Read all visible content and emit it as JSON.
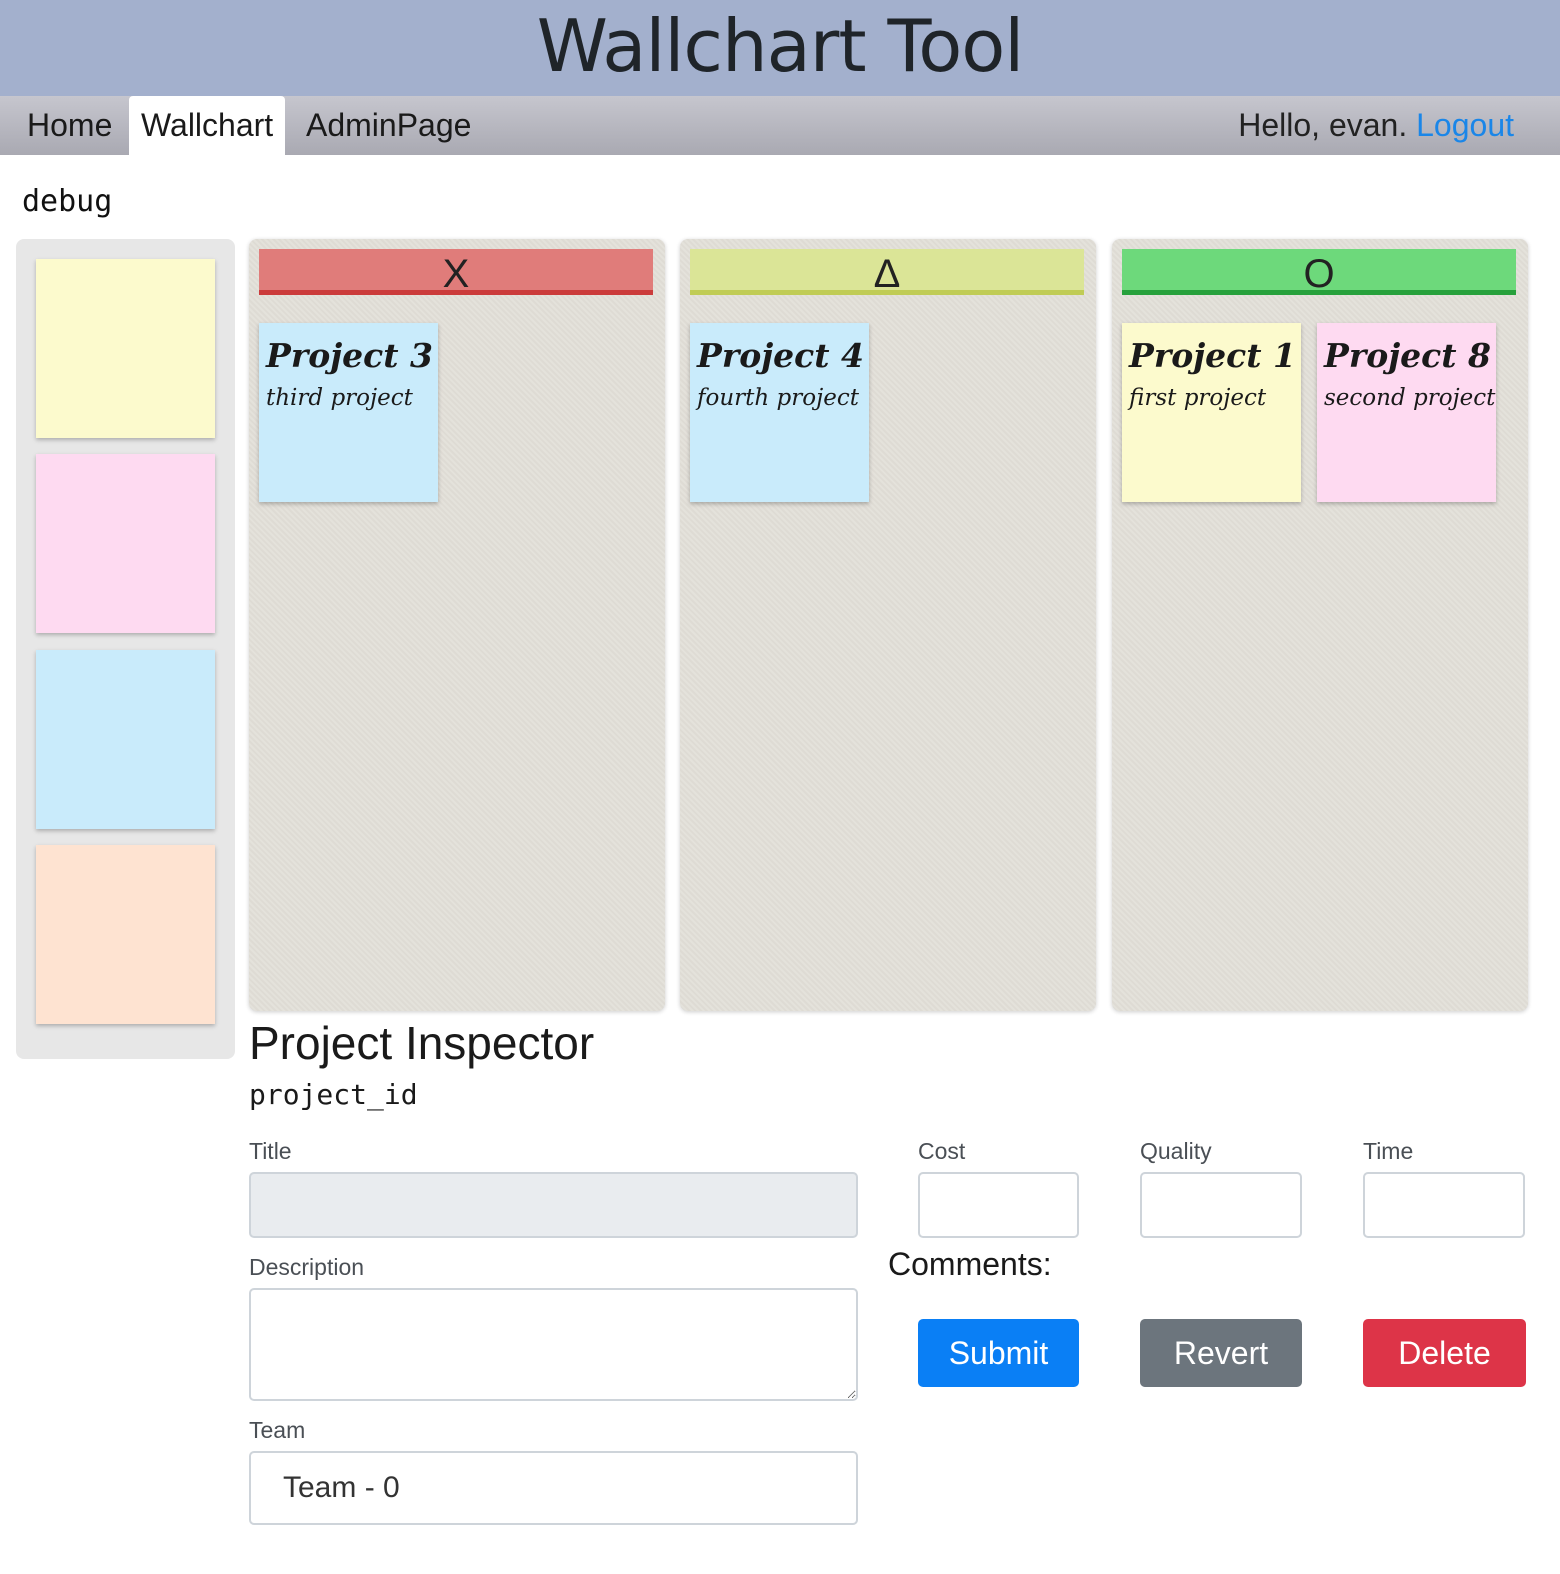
{
  "header": {
    "title": "Wallchart Tool"
  },
  "nav": {
    "tabs": [
      {
        "label": "Home"
      },
      {
        "label": "Wallchart"
      },
      {
        "label": "AdminPage"
      }
    ],
    "greeting": "Hello, evan.",
    "logout": "Logout"
  },
  "debug_label": "debug",
  "palette": {
    "colors": [
      "#fcfacd",
      "#fedaf1",
      "#c9ebfb",
      "#fee3d1"
    ]
  },
  "columns": [
    {
      "header": "X",
      "header_color": "#e07c7a",
      "header_border": "#cb3b3b",
      "notes": [
        {
          "title": "Project 3",
          "description": "third project",
          "color": "#c9ebfb"
        }
      ]
    },
    {
      "header": "Δ",
      "header_color": "#dbe597",
      "header_border": "#c0cc55",
      "notes": [
        {
          "title": "Project 4",
          "description": "fourth project",
          "color": "#c9ebfb"
        }
      ]
    },
    {
      "header": "O",
      "header_color": "#6dd97b",
      "header_border": "#27a13c",
      "notes": [
        {
          "title": "Project 1",
          "description": "first project",
          "color": "#fcfacd"
        },
        {
          "title": "Project 8",
          "description": "second project",
          "color": "#fedaf1"
        }
      ]
    }
  ],
  "inspector": {
    "title": "Project Inspector",
    "project_id": "project_id",
    "title_label": "Title",
    "title_value": "",
    "description_label": "Description",
    "description_value": "",
    "team_label": "Team",
    "team_value": "Team - 0",
    "cost_label": "Cost",
    "cost_value": "",
    "quality_label": "Quality",
    "quality_value": "",
    "time_label": "Time",
    "time_value": "",
    "comments_label": "Comments:",
    "submit_label": "Submit",
    "revert_label": "Revert",
    "delete_label": "Delete",
    "submit_color": "#0a7ff5",
    "revert_color": "#6c757d",
    "delete_color": "#dd3448"
  }
}
